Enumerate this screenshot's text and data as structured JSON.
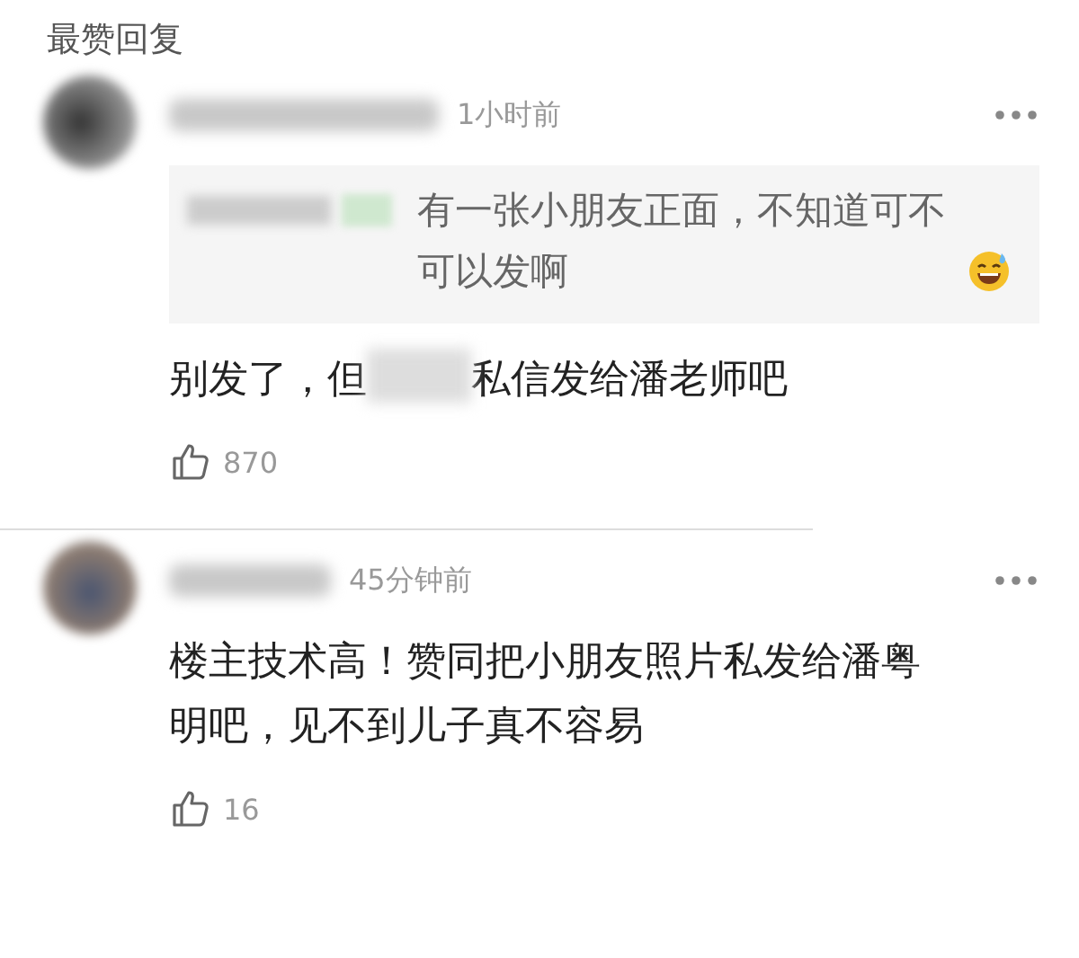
{
  "section_title": "最赞回复",
  "comments": [
    {
      "time": "1小时前",
      "quote": {
        "text": "有一张小朋友正面，不知道可不可以发啊"
      },
      "text_parts": [
        "别发了，但",
        "私信发给潘老师吧"
      ],
      "likes": "870",
      "divider": true
    },
    {
      "time": "45分钟前",
      "text_parts": [
        "楼主技术高！赞同把小朋友照片私发给潘粤明吧，见不到儿子真不容易"
      ],
      "likes": "16",
      "divider": false
    }
  ]
}
